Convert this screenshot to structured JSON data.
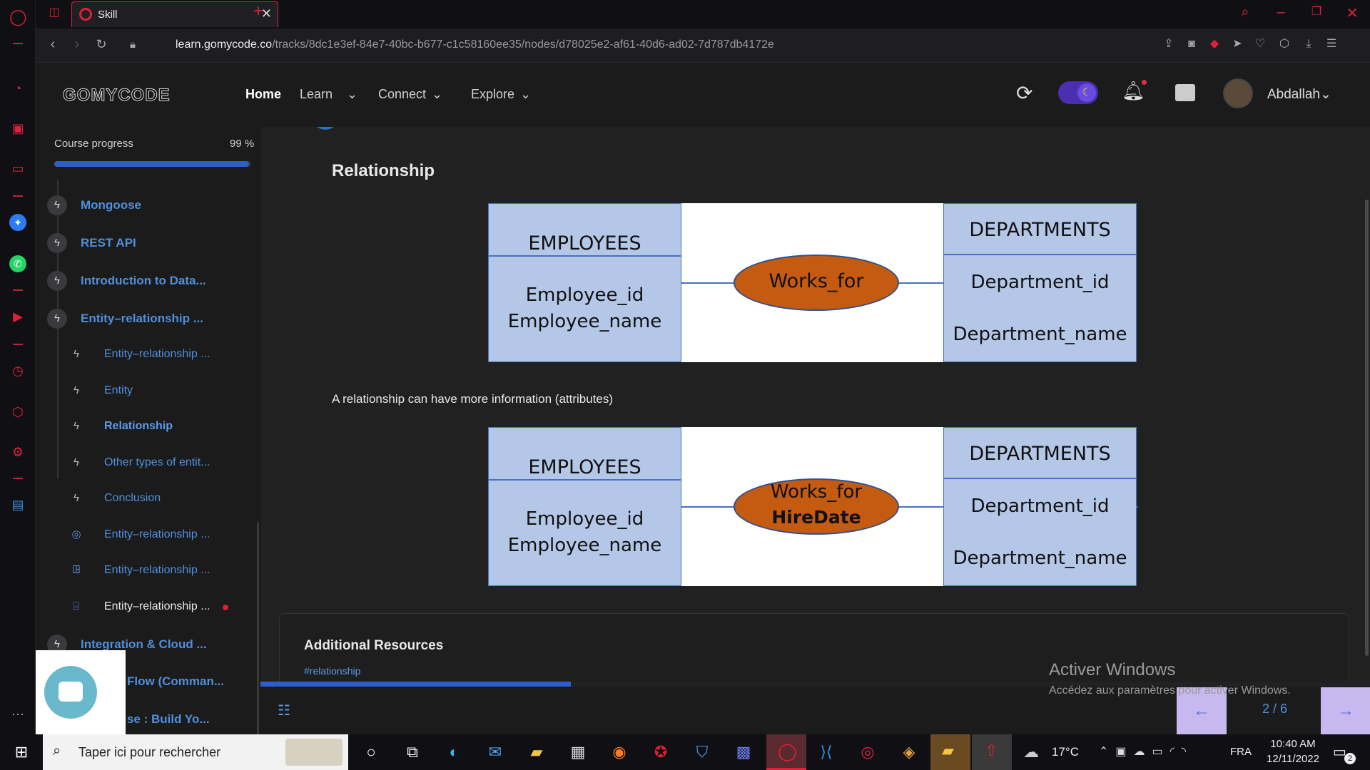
{
  "browser": {
    "tab_title": "Skill",
    "url_host": "learn.gomycode.co",
    "url_path": "/tracks/8dc1e3ef-84e7-40bc-b677-c1c58160ee35/nodes/d78025e2-af61-40d6-ad02-7d787db4172e"
  },
  "header": {
    "logo": "GOMYCODE",
    "nav": [
      "Home",
      "Learn",
      "Connect",
      "Explore"
    ],
    "username": "Abdallah"
  },
  "sidebar": {
    "progress_label": "Course progress",
    "progress_value": "99 %",
    "progress_fraction": 0.99,
    "modules": [
      {
        "label": "Mongoose",
        "icon": "bolt-icon"
      },
      {
        "label": "REST API",
        "icon": "bolt-icon"
      },
      {
        "label": "Introduction to Data...",
        "icon": "bolt-icon"
      },
      {
        "label": "Entity–relationship ...",
        "icon": "bolt-icon"
      }
    ],
    "lessons": [
      {
        "label": "Entity–relationship ...",
        "icon": "bolt-icon"
      },
      {
        "label": "Entity",
        "icon": "bolt-icon"
      },
      {
        "label": "Relationship",
        "icon": "bolt-icon",
        "active": true
      },
      {
        "label": "Other types of entit...",
        "icon": "bolt-icon"
      },
      {
        "label": "Conclusion",
        "icon": "bolt-icon"
      },
      {
        "label": "Entity–relationship ...",
        "icon": "target-icon"
      },
      {
        "label": "Entity–relationship ...",
        "icon": "people-icon"
      },
      {
        "label": "Entity–relationship ...",
        "icon": "board-icon"
      }
    ],
    "more_modules": [
      {
        "label": "Integration & Cloud ..."
      },
      {
        "label": "Flow (Comman..."
      },
      {
        "label": "se : Build Yo..."
      }
    ]
  },
  "content": {
    "heading": "Relationship",
    "diagram1": {
      "left_title": "EMPLOYEES",
      "left_attrs": [
        "Employee_id",
        "Employee_name"
      ],
      "relation": "Works_for",
      "right_title": "DEPARTMENTS",
      "right_attrs": [
        "Department_id",
        "Department_name"
      ]
    },
    "paragraph": "A relationship can have more information (attributes)",
    "diagram2": {
      "left_title": "EMPLOYEES",
      "left_attrs": [
        "Employee_id",
        "Employee_name"
      ],
      "relation": "Works_for",
      "relation_attr": "HireDate",
      "right_title": "DEPARTMENTS",
      "right_attrs": [
        "Department_id",
        "Department_name"
      ]
    },
    "resources_title": "Additional Resources",
    "resource_tag": "#relationship",
    "pagination": "2 / 6",
    "scroll_progress_fraction": 0.28
  },
  "watermark": {
    "title": "Activer Windows",
    "subtitle": "Accédez aux paramètres pour activer Windows."
  },
  "taskbar": {
    "search_placeholder": "Taper ici pour rechercher",
    "weather": "17°C",
    "language": "FRA",
    "time": "10:40 AM",
    "date": "12/11/2022",
    "notification_count": "2"
  },
  "colors": {
    "accent_blue": "#4f8fdc",
    "opera_red": "#e0203a",
    "entity_fill": "#b4c7e7",
    "relation_fill": "#c55a11"
  }
}
